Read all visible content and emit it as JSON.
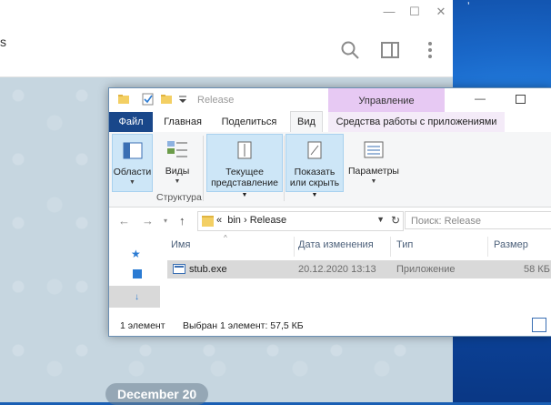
{
  "telegram": {
    "date_pill": "December 20",
    "controls": {
      "minimize": "—",
      "maximize": "☐",
      "close": "✕"
    },
    "header_edge_glyph": "s"
  },
  "explorer": {
    "title": "Release",
    "context_tab": "Управление",
    "ribbon_tabs": {
      "file": "Файл",
      "home": "Главная",
      "share": "Поделиться",
      "view": "Вид",
      "app_tools": "Средства работы с приложениями"
    },
    "ribbon": {
      "areas": "Области",
      "views": "Виды",
      "current_view_1": "Текущее",
      "current_view_2": "представление",
      "show_hide_1": "Показать",
      "show_hide_2": "или скрыть",
      "options": "Параметры",
      "group_structure": "Структура"
    },
    "address": {
      "prefix": "«",
      "segments": [
        "bin",
        "Release"
      ],
      "separator": "›",
      "search_placeholder": "Поиск: Release"
    },
    "columns": {
      "name": "Имя",
      "date": "Дата изменения",
      "type": "Тип",
      "size": "Размер"
    },
    "files": [
      {
        "name": "stub.exe",
        "date": "20.12.2020 13:13",
        "type": "Приложение",
        "size": "58 КБ"
      }
    ],
    "status": {
      "count": "1 элемент",
      "selected": "Выбран 1 элемент: 57,5 КБ"
    }
  },
  "colors": {
    "file_tab": "#19478a",
    "context_tab": "#e7c9f3",
    "selection": "#d9d9d9",
    "ribbon_selected": "#cde6f7"
  }
}
